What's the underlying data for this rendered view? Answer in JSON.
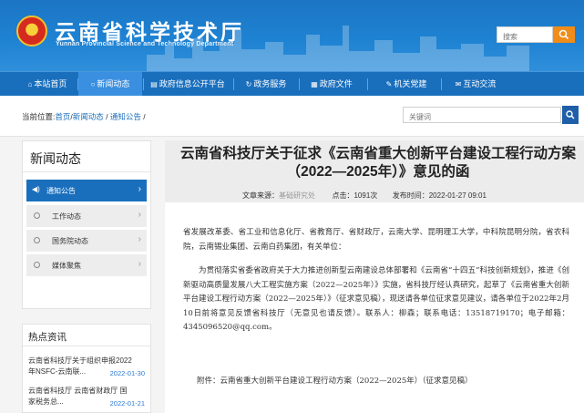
{
  "header": {
    "title": "云南省科学技术厅",
    "subtitle": "Yunnan Provincial Science and Technology Department",
    "search_placeholder": "搜索"
  },
  "nav": {
    "items": [
      {
        "label": "本站首页",
        "icon": "home-icon"
      },
      {
        "label": "新闻动态",
        "icon": "circle-icon",
        "active": true
      },
      {
        "label": "政府信息公开平台",
        "icon": "list-icon"
      },
      {
        "label": "政务服务",
        "icon": "refresh-icon"
      },
      {
        "label": "政府文件",
        "icon": "document-icon"
      },
      {
        "label": "机关党建",
        "icon": "wrench-icon"
      },
      {
        "label": "互动交流",
        "icon": "chat-icon"
      }
    ]
  },
  "breadcrumb": {
    "prefix": "当前位置:",
    "home": "首页",
    "section": "新闻动态",
    "current": "通知公告",
    "sep": "/"
  },
  "keyword_search": {
    "placeholder": "关键词"
  },
  "sidebar": {
    "heading": "新闻动态",
    "items": [
      {
        "label": "通知公告",
        "active": true
      },
      {
        "label": "工作动态"
      },
      {
        "label": "国务院动态"
      },
      {
        "label": "媒体聚焦"
      }
    ],
    "arrow": "›"
  },
  "hot": {
    "heading": "热点资讯",
    "items": [
      {
        "title_line1": "云南省科技厅关于组织申报2022",
        "title_line2": "年NSFC-云南联...",
        "date": "2022-01-30"
      },
      {
        "title_line1": "云南省科技厅 云南省财政厅 国",
        "title_line2": "家税务总...",
        "date": "2022-01-21"
      }
    ]
  },
  "article": {
    "title": "云南省科技厅关于征求《云南省重大创新平台建设工程行动方案（2022—2025年）》意见的函",
    "source_label": "文章来源：",
    "source": "基础研究处",
    "clicks_label": "点击：",
    "clicks": "1091次",
    "time_label": "发布时间：",
    "time": "2022-01-27 09:01",
    "para1": "省发展改革委、省工业和信息化厅、省教育厅、省财政厅，云南大学、昆明理工大学，中科院昆明分院，省农科院，云南锡业集团、云南白药集团，有关单位：",
    "para2": "为贯彻落实省委省政府关于大力推进创新型云南建设总体部署和《云南省“十四五”科技创新规划》，推进《创新驱动高质量发展八大工程实施方案（2022—2025年）》实施，省科技厅经认真研究，起草了《云南省重大创新平台建设工程行动方案（2022—2025年）》（征求意见稿），现送请各单位征求意见建议，请各单位于2022年2月10日前将意见反馈省科技厅（无意见也请反馈）。联系人：柳森；联系电话：13518719170；电子邮箱：4345096520@qq.com。",
    "attachment": "附件：云南省重大创新平台建设工程行动方案（2022—2025年）（征求意见稿）"
  }
}
